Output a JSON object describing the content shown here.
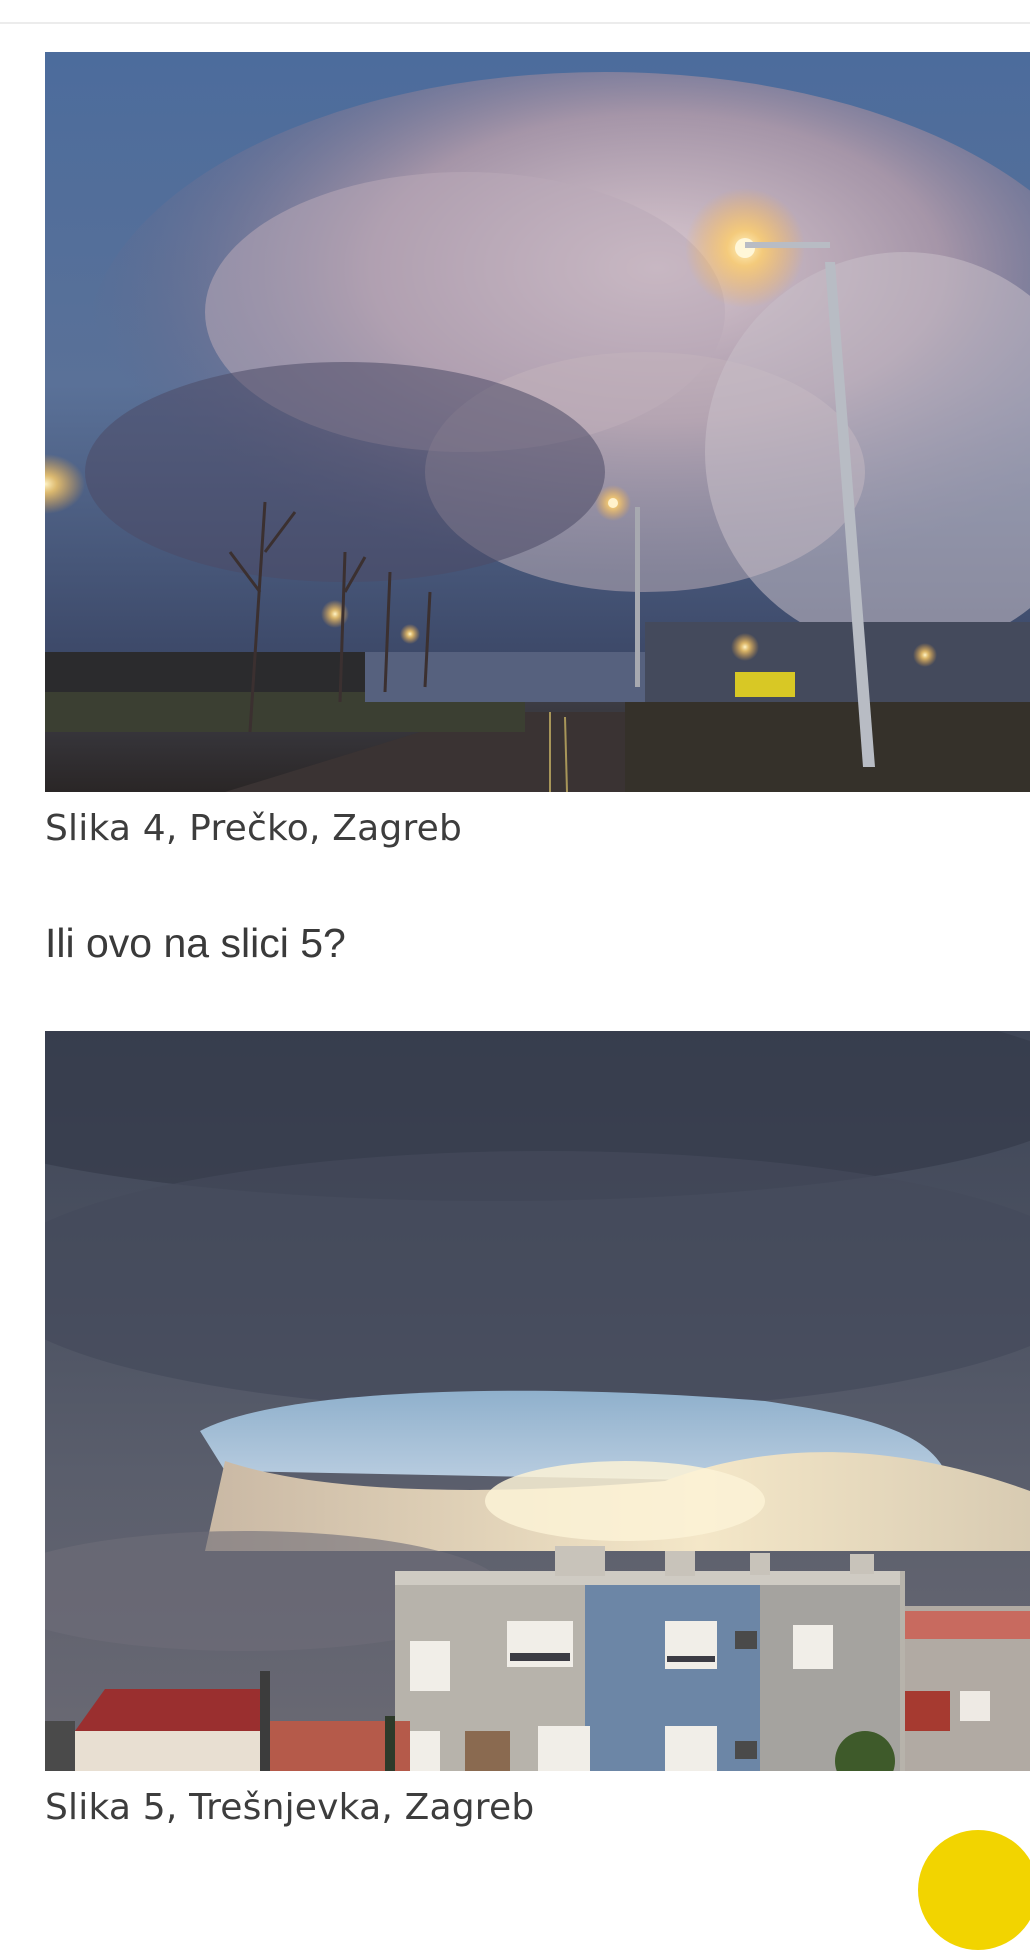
{
  "figures": [
    {
      "caption": "Slika 4, Prečko, Zagreb",
      "image_subject": "storm-clouds-over-street-with-lamps"
    },
    {
      "caption": "Slika 5, Trešnjevka, Zagreb",
      "image_subject": "dark-clouds-over-buildings"
    }
  ],
  "paragraph": "Ili ovo na slici 5?",
  "colors": {
    "caption_text": "#3d3d3d",
    "body_text": "#3a3a3a",
    "fab_accent": "#f2d400"
  }
}
